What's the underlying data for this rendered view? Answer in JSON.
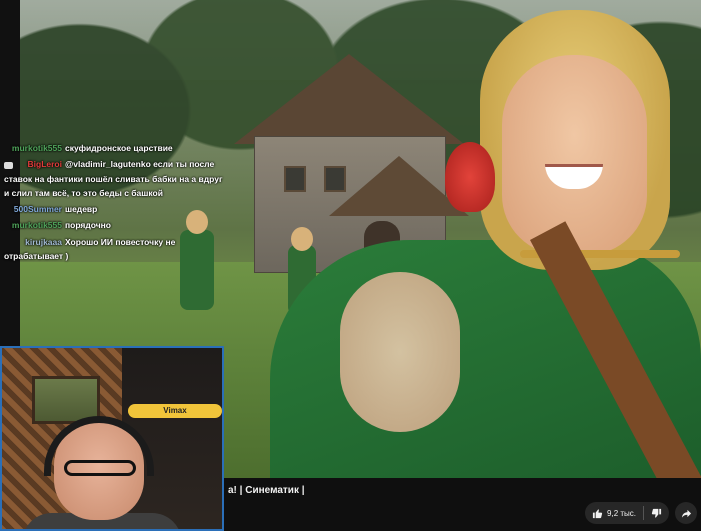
{
  "chat": {
    "messages": [
      {
        "user": "murkotik555",
        "user_color": "#4fa35a",
        "text": "скуфидронское царствие",
        "badge": false
      },
      {
        "user": "BigLeroi",
        "user_color": "#e03a3a",
        "text": "@vladimir_lagutenko если ты после ставок на фантики пошёл сливать бабки на а вдруг и слил там всё, то это беды с башкой",
        "badge": true
      },
      {
        "user": "500Summer",
        "user_color": "#7fa7d8",
        "text": "шедевр",
        "badge": false
      },
      {
        "user": "murkotik555",
        "user_color": "#4fa35a",
        "text": "порядочно",
        "badge": false
      },
      {
        "user": "kirujkaaa",
        "user_color": "#9fb8d0",
        "text": "Хорошо ИИ повесточку не отрабатывает )",
        "badge": false
      }
    ]
  },
  "webcam": {
    "logo_text": "Vimax",
    "border_color": "#2b6fb8"
  },
  "video": {
    "title_fragment": "а! | Синематик |"
  },
  "actions": {
    "likes": "9,2 тыс.",
    "like_icon": "thumbs-up-icon",
    "dislike_icon": "thumbs-down-icon",
    "share_icon": "share-icon"
  }
}
